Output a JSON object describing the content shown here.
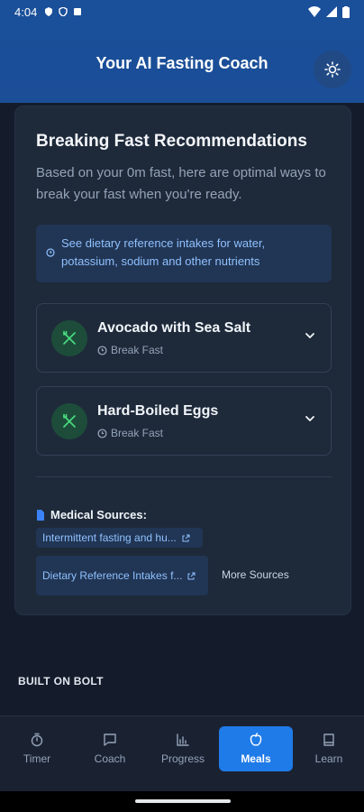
{
  "status_bar": {
    "time": "4:04"
  },
  "header": {
    "title": "Your AI Fasting Coach",
    "theme_icon": "sun-icon"
  },
  "card": {
    "title": "Breaking Fast Recommendations",
    "subtitle": "Based on your 0m fast, here are optimal ways to break your fast when you're ready.",
    "info": "See dietary reference intakes for water, potassium, sodium and other nutrients",
    "foods": [
      {
        "name": "Avocado with Sea Salt",
        "meta": "Break Fast"
      },
      {
        "name": "Hard-Boiled Eggs",
        "meta": "Break Fast"
      }
    ],
    "sources_title": "Medical Sources:",
    "sources": [
      "Intermittent fasting and hu...",
      "Dietary Reference Intakes f..."
    ],
    "more_sources": "More Sources"
  },
  "footer": {
    "built": "BUILT ON BOLT"
  },
  "nav": {
    "items": [
      {
        "label": "Timer",
        "icon": "timer-icon"
      },
      {
        "label": "Coach",
        "icon": "chat-icon"
      },
      {
        "label": "Progress",
        "icon": "chart-icon"
      },
      {
        "label": "Meals",
        "icon": "apple-icon",
        "active": true
      },
      {
        "label": "Learn",
        "icon": "book-icon"
      }
    ]
  },
  "colors": {
    "accent": "#1f7be8",
    "header": "#1a4f99",
    "background": "#141c2b"
  }
}
